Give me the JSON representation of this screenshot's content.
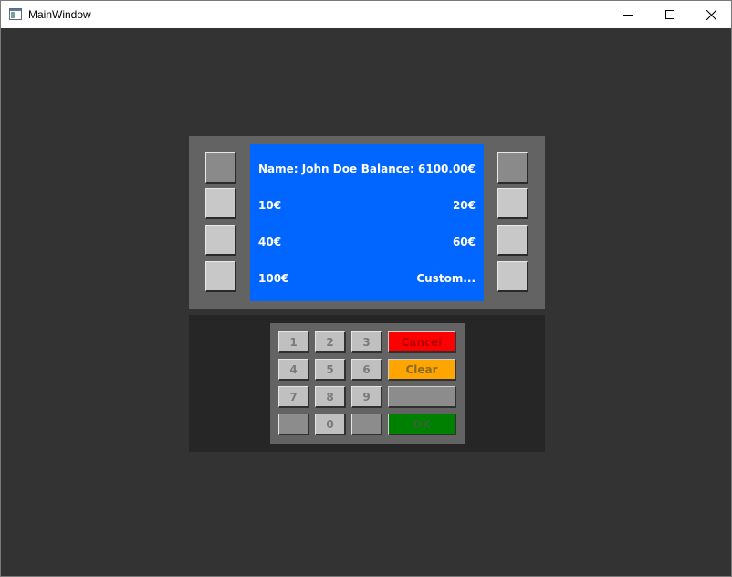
{
  "window": {
    "title": "MainWindow"
  },
  "screen": {
    "name_label": "Name: John Doe",
    "balance_label": "Balance: 6100.00€",
    "options": [
      {
        "left": "10€",
        "right": "20€"
      },
      {
        "left": "40€",
        "right": "60€"
      },
      {
        "left": "100€",
        "right": "Custom..."
      }
    ]
  },
  "keypad": {
    "digits": [
      "1",
      "2",
      "3",
      "4",
      "5",
      "6",
      "7",
      "8",
      "9",
      "",
      "0",
      ""
    ],
    "cancel_label": "Cancel",
    "clear_label": "Clear",
    "blank_label": "",
    "ok_label": "OK"
  },
  "colors": {
    "display_bg": "#0066ff",
    "cancel_bg": "#ff0000",
    "cancel_text": "#b80000",
    "clear_bg": "#ffa500",
    "clear_text": "#8a6a2a",
    "ok_bg": "#008000",
    "ok_text": "#2f6a2f"
  }
}
